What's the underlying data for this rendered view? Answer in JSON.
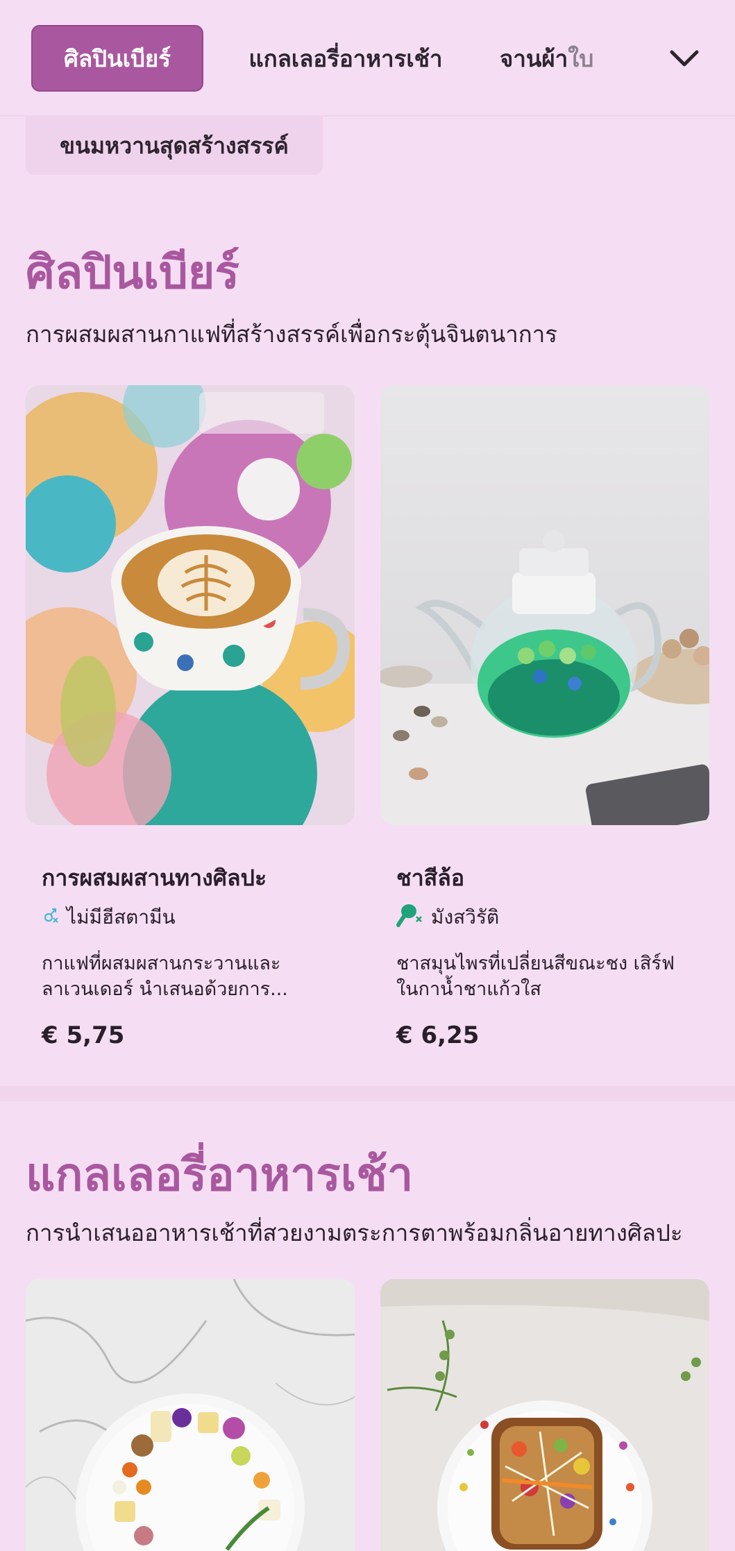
{
  "nav": {
    "tabs": [
      {
        "label": "ศิลปินเบียร์",
        "active": true
      },
      {
        "label": "แกลเลอรี่อาหารเช้า",
        "active": false
      },
      {
        "label": "จานผ้า",
        "label_faded": "ใบ",
        "active": false
      }
    ],
    "more_icon": "chevron-down-icon",
    "second_row_chip": "ขนมหวานสุดสร้างสรรค์"
  },
  "colors": {
    "accent": "#a9589f",
    "background": "#f5def3",
    "green": "#1fa37a",
    "cyan": "#47b7d9"
  },
  "sections": [
    {
      "title": "ศิลปินเบียร์",
      "subtitle": "การผสมผสานกาแฟที่สร้างสรรค์เพื่อกระตุ้นจินตนาการ",
      "items": [
        {
          "name": "การผสมผสานทางศิลปะ",
          "diet_icon": "no-histamine-icon",
          "diet_label": "ไม่มีฮีสตามีน",
          "description": "กาแฟที่ผสมผสานกระวานและลาเวนเดอร์ นำเสนอด้วยการ...",
          "price": "€ 5,75"
        },
        {
          "name": "ชาสีล้อ",
          "diet_icon": "vegetarian-drumstick-icon",
          "diet_label": "มังสวิรัติ",
          "description": "ชาสมุนไพรที่เปลี่ยนสีขณะชง เสิร์ฟในกาน้ำชาแก้วใส",
          "price": "€ 6,25"
        }
      ]
    },
    {
      "title": "แกลเลอรี่อาหารเช้า",
      "subtitle": "การนำเสนออาหารเช้าที่สวยงามตระการตาพร้อมกลิ่นอายทางศิลปะ"
    }
  ]
}
